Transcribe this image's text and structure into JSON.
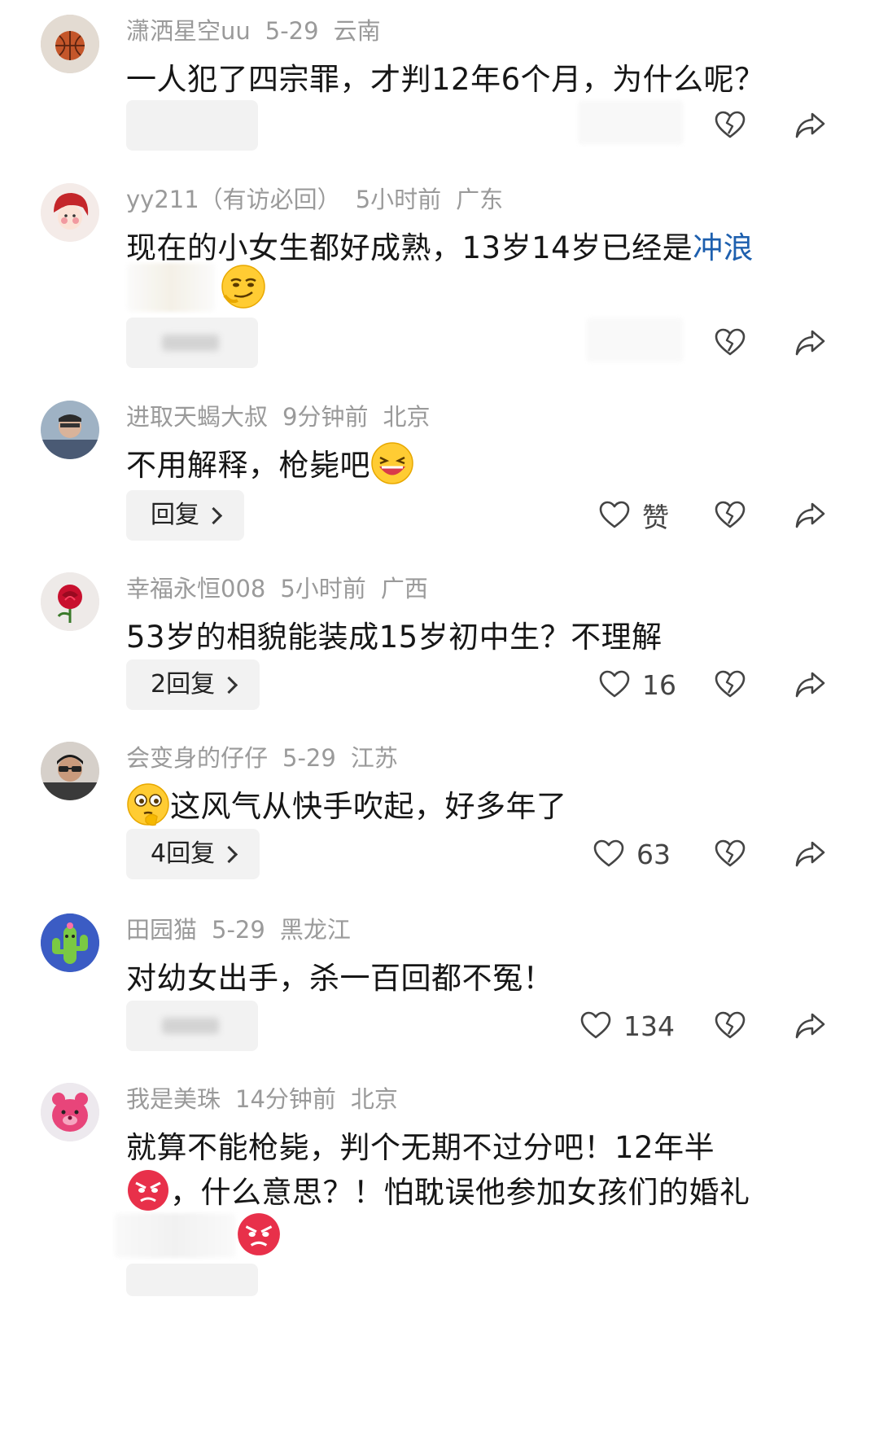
{
  "comments": [
    {
      "username": "潇洒星空uu",
      "time": "5-29",
      "location": "云南",
      "text": "一人犯了四宗罪，才判12年6个月，为什么呢？",
      "reply_label": "",
      "like_label": ""
    },
    {
      "username": "yy211（有访必回）",
      "time": "5小时前",
      "location": "广东",
      "text": "现在的小女生都好成熟，13岁14岁已经是",
      "text_link": "冲浪",
      "reply_label": "",
      "like_label": ""
    },
    {
      "username": "进取天蝎大叔",
      "time": "9分钟前",
      "location": "北京",
      "text": "不用解释，枪毙吧",
      "reply_label": "回复",
      "like_label": "赞"
    },
    {
      "username": "幸福永恒008",
      "time": "5小时前",
      "location": "广西",
      "text": "53岁的相貌能装成15岁初中生？不理解",
      "reply_label": "2回复",
      "like_label": "16"
    },
    {
      "username": "会变身的仔仔",
      "time": "5-29",
      "location": "江苏",
      "text": "这风气从快手吹起，好多年了",
      "reply_label": "4回复",
      "like_label": "63"
    },
    {
      "username": "田园猫",
      "time": "5-29",
      "location": "黑龙江",
      "text": "对幼女出手，杀一百回都不冤！",
      "reply_label": "",
      "like_label": "134"
    },
    {
      "username": "我是美珠",
      "time": "14分钟前",
      "location": "北京",
      "text_line1": "就算不能枪毙，判个无期不过分吧！12年半",
      "text_line2": "，什么意思？！怕耽误他参加女孩们的婚礼",
      "reply_label": "",
      "like_label": ""
    }
  ],
  "icons": {
    "like": "heart-outline-icon",
    "dislike": "broken-heart-icon",
    "share": "share-arrow-icon"
  },
  "colors": {
    "meta": "#9a9a9a",
    "text": "#161616",
    "link": "#1d5fae",
    "reply_bg": "#f2f2f2"
  }
}
